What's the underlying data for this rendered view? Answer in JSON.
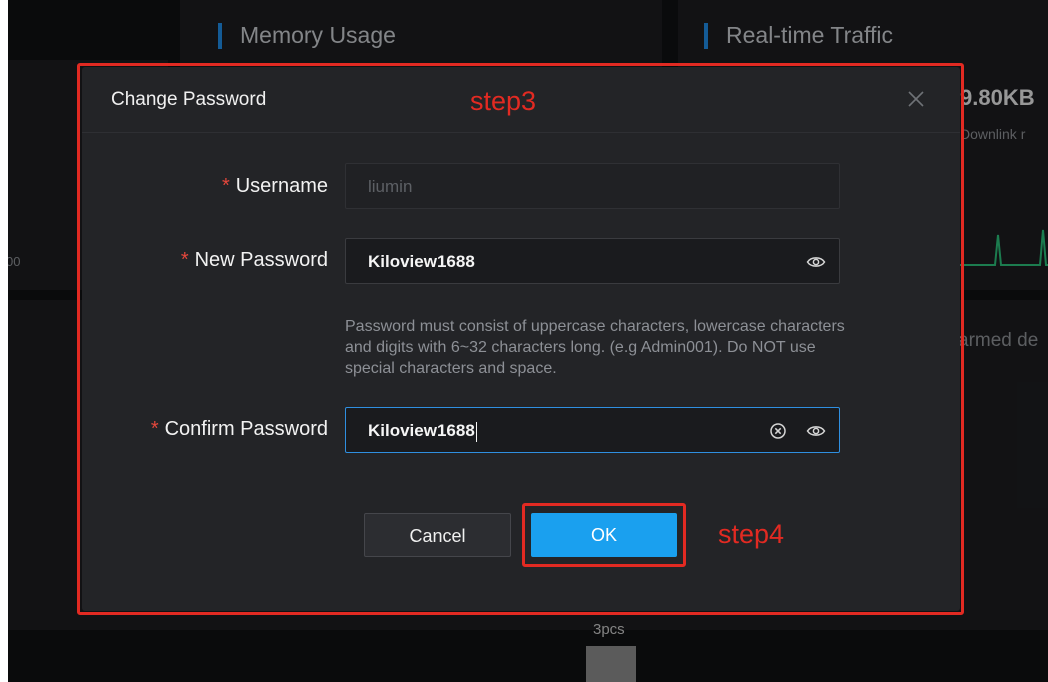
{
  "background": {
    "memory_card": {
      "title": "Memory Usage",
      "axis_tick": "00"
    },
    "traffic_card": {
      "title": "Real-time Traffic",
      "value": "9.80KB",
      "sub_label": "Downlink r",
      "alarm_text": "armed de"
    },
    "bottom_label": "3pcs"
  },
  "dialog": {
    "title": "Change Password",
    "fields": {
      "username": {
        "label": "Username",
        "required_mark": "*",
        "value": "liumin"
      },
      "new_password": {
        "label": "New Password",
        "required_mark": "*",
        "value": "Kiloview1688"
      },
      "confirm_password": {
        "label": "Confirm Password",
        "required_mark": "*",
        "value": "Kiloview1688"
      }
    },
    "hint": "Password must consist of uppercase characters, lowercase characters and digits with 6~32 characters long. (e.g Admin001). Do NOT use special characters and space.",
    "cancel_label": "Cancel",
    "ok_label": "OK"
  },
  "annotations": {
    "step3": "step3",
    "step4": "step4",
    "color": "#e22a22"
  },
  "colors": {
    "accent": "#1aa0ef",
    "required": "#e4473c",
    "card_bar": "#1f8ce6"
  },
  "icons": {
    "close": "close-icon",
    "eye": "eye-icon",
    "clear": "clear-icon"
  }
}
